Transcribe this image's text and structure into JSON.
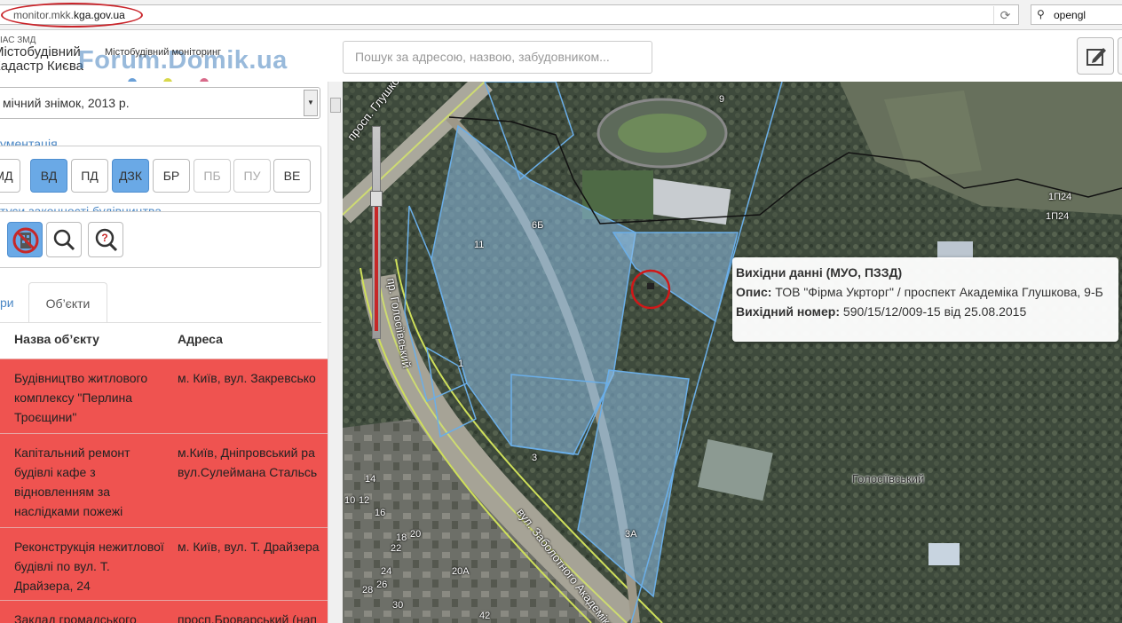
{
  "browser": {
    "url_prefix": "monitor.mkk.",
    "url_domain": "kga.gov.ua",
    "search_query": "opengl",
    "reload_icon": "⟳",
    "search_icon": "⚲"
  },
  "header": {
    "logo_small": "ІАС ЗМД",
    "logo_line1": "Містобудівний",
    "logo_line2": "Кадастр Києва",
    "logo_sub": "Містобудівний моніторинг",
    "watermark": "Forum.Domik.ua",
    "search_placeholder": "Пошук за адресою, назвою, забудовником...",
    "edit_icon": "edit-icon",
    "dot_colors": [
      "#6aa0d8",
      "#d8d84a",
      "#d86a8a"
    ]
  },
  "sidebar": {
    "layer_select": "мічний знімок, 2013 р.",
    "select_arrow": "▼",
    "docs_title": "ументація",
    "doc_buttons": [
      {
        "label": "МД",
        "state": "normal"
      },
      {
        "label": "ВД",
        "state": "active"
      },
      {
        "label": "ПД",
        "state": "normal"
      },
      {
        "label": "ДЗК",
        "state": "active"
      },
      {
        "label": "БР",
        "state": "normal"
      },
      {
        "label": "ПБ",
        "state": "disabled"
      },
      {
        "label": "ПУ",
        "state": "disabled"
      },
      {
        "label": "ВЕ",
        "state": "normal"
      }
    ],
    "status_title": "туси законності будівництва",
    "tabs": [
      {
        "label": "ри"
      },
      {
        "label": "Об’єкти"
      }
    ],
    "columns": [
      "Назва об’єкту",
      "Адреса"
    ],
    "rows": [
      {
        "name": "Будівництво житлового комплексу \"Перлина Троєщини\"",
        "address": "м. Київ, вул. Закревсько"
      },
      {
        "name": "Капітальний ремонт будівлі кафе з відновленням за наслідками пожежі",
        "address": "м.Київ, Дніпровський ра вул.Сулеймана Стальсь"
      },
      {
        "name": "Реконструкція нежитлової будівлі по вул. Т. Драйзера, 24",
        "address": "м. Київ, вул. Т. Драйзера"
      },
      {
        "name": "Заклад громадського",
        "address": "просп.Броварський (нап"
      }
    ]
  },
  "map": {
    "popup": {
      "heading": "Вихідни данні (МУО, ПЗЗД)",
      "desc_label": "Опис:",
      "desc_value": "ТОВ \"Фірма Укрторг\" / проспект Академіка Глушкова, 9-Б",
      "num_label": "Вихідний номер:",
      "num_value": "590/15/12/009-15 від 25.08.2015"
    },
    "labels": {
      "street1": "просп. Глушкова Академіка",
      "street2": "пр. Голосіївський",
      "street3": "вул. Заболотного Академіка",
      "district": "Голосіївський",
      "p9": "9",
      "p11": "11",
      "p6b": "6Б",
      "p1": "1",
      "p3": "3",
      "p3a": "3А",
      "p1p24a": "1П24",
      "p1p24b": "1П24",
      "p14": "14",
      "p10": "10",
      "p12": "12",
      "p16": "16",
      "p18": "18",
      "p20": "20",
      "p22": "22",
      "p24": "24",
      "p26": "26",
      "p28": "28",
      "p30": "30",
      "p20a": "20А",
      "p42": "42"
    }
  }
}
